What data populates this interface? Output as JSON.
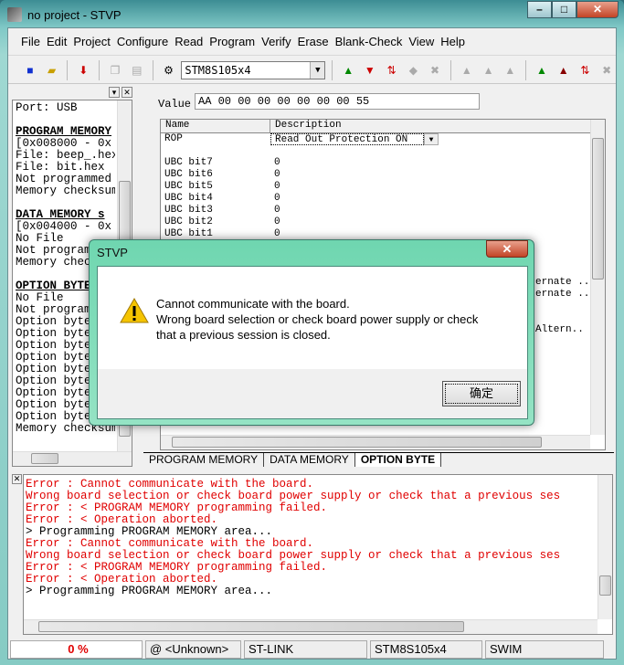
{
  "window": {
    "title": "no project - STVP"
  },
  "menu": [
    "File",
    "Edit",
    "Project",
    "Configure",
    "Read",
    "Program",
    "Verify",
    "Erase",
    "Blank-Check",
    "View",
    "Help"
  ],
  "toolbar": {
    "device": "STM8S105x4"
  },
  "left_panel": {
    "lines": [
      {
        "t": "Port: USB",
        "h": false
      },
      {
        "t": "",
        "h": false
      },
      {
        "t": "PROGRAM MEMORY",
        "h": true
      },
      {
        "t": "[0x008000 - 0x",
        "h": false
      },
      {
        "t": "File: beep_.hex",
        "h": false
      },
      {
        "t": "File: bit.hex",
        "h": false
      },
      {
        "t": "Not programmed",
        "h": false
      },
      {
        "t": "Memory checksum",
        "h": false
      },
      {
        "t": "",
        "h": false
      },
      {
        "t": "DATA MEMORY s",
        "h": true
      },
      {
        "t": "[0x004000 - 0x",
        "h": false
      },
      {
        "t": "No File",
        "h": false
      },
      {
        "t": "Not programmed",
        "h": false
      },
      {
        "t": "Memory checksum",
        "h": false
      },
      {
        "t": "",
        "h": false
      },
      {
        "t": "OPTION BYTE",
        "h": true
      },
      {
        "t": "No File",
        "h": false
      },
      {
        "t": "Not programmed",
        "h": false
      },
      {
        "t": "Option byte",
        "h": false
      },
      {
        "t": "Option byte",
        "h": false
      },
      {
        "t": "Option byte",
        "h": false
      },
      {
        "t": "Option byte",
        "h": false
      },
      {
        "t": "Option byte",
        "h": false
      },
      {
        "t": "Option byte",
        "h": false
      },
      {
        "t": "Option byte",
        "h": false
      },
      {
        "t": "Option byte",
        "h": false
      },
      {
        "t": "Option byte",
        "h": false
      },
      {
        "t": "Memory checksum",
        "h": false
      }
    ]
  },
  "main": {
    "value_label": "Value",
    "value": "AA 00 00 00 00 00 00 00 55",
    "columns": [
      "Name",
      "Description"
    ],
    "rop": {
      "name": "ROP",
      "desc": "Read Out Protection ON"
    },
    "rows": [
      {
        "n": "",
        "d": ""
      },
      {
        "n": "UBC bit7",
        "d": "0"
      },
      {
        "n": "UBC bit6",
        "d": "0"
      },
      {
        "n": "UBC bit5",
        "d": "0"
      },
      {
        "n": "UBC bit4",
        "d": "0"
      },
      {
        "n": "UBC bit3",
        "d": "0"
      },
      {
        "n": "UBC bit2",
        "d": "0"
      },
      {
        "n": "UBC bit1",
        "d": "0"
      }
    ],
    "partial": [
      "ernate ..",
      "ernate ..",
      "Altern.."
    ],
    "tabs": [
      "PROGRAM MEMORY",
      "DATA MEMORY",
      "OPTION BYTE"
    ]
  },
  "log": [
    {
      "t": "Error : Cannot communicate with the board.",
      "e": true
    },
    {
      "t": "Wrong board selection or check board power supply or check that a previous ses",
      "e": true
    },
    {
      "t": "Error : < PROGRAM MEMORY programming failed.",
      "e": true
    },
    {
      "t": "Error : < Operation aborted.",
      "e": true
    },
    {
      "t": "> Programming  PROGRAM MEMORY area...",
      "e": false
    },
    {
      "t": "Error : Cannot communicate with the board.",
      "e": true
    },
    {
      "t": "Wrong board selection or check board power supply or check that a previous ses",
      "e": true
    },
    {
      "t": "Error : < PROGRAM MEMORY programming failed.",
      "e": true
    },
    {
      "t": "Error : < Operation aborted.",
      "e": true
    },
    {
      "t": "> Programming  PROGRAM MEMORY area...",
      "e": false
    }
  ],
  "status": {
    "progress": "0 %",
    "address": "@ <Unknown>",
    "tool": "ST-LINK",
    "device": "STM8S105x4",
    "protocol": "SWIM"
  },
  "dialog": {
    "title": "STVP",
    "line1": "Cannot communicate with the board.",
    "line2": "Wrong board selection or check board power supply or check",
    "line3": "that a previous session is closed.",
    "ok": "确定"
  }
}
